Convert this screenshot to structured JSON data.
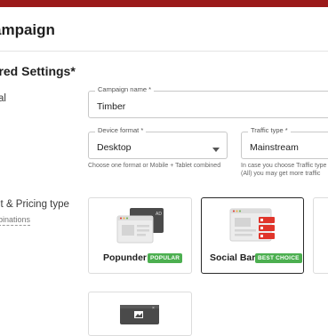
{
  "page": {
    "title": "ampaign"
  },
  "section": {
    "title": "uired Settings*"
  },
  "left_labels": {
    "general": "al",
    "format": "it & Pricing type",
    "format_sub": "binations"
  },
  "fields": {
    "campaign_name": {
      "label": "Campaign name *",
      "value": "Timber"
    },
    "device_format": {
      "label": "Device format *",
      "value": "Desktop",
      "helper": "Choose one format or Mobile + Tablet combined"
    },
    "traffic_type": {
      "label": "Traffic type *",
      "value": "Mainstream",
      "helper_line1": "In case you choose Traffic type - M",
      "helper_line2": "(All) you may get more traffic"
    }
  },
  "formats": [
    {
      "name": "Popunder",
      "badge": "POPULAR",
      "icon": "popunder-icon",
      "selected": false
    },
    {
      "name": "Social Bar",
      "badge": "BEST CHOICE",
      "icon": "social-bar-icon",
      "selected": true
    }
  ],
  "colors": {
    "brand_bar": "#9b1a1a",
    "badge_green": "#4caf50",
    "social_red": "#e0352b"
  }
}
